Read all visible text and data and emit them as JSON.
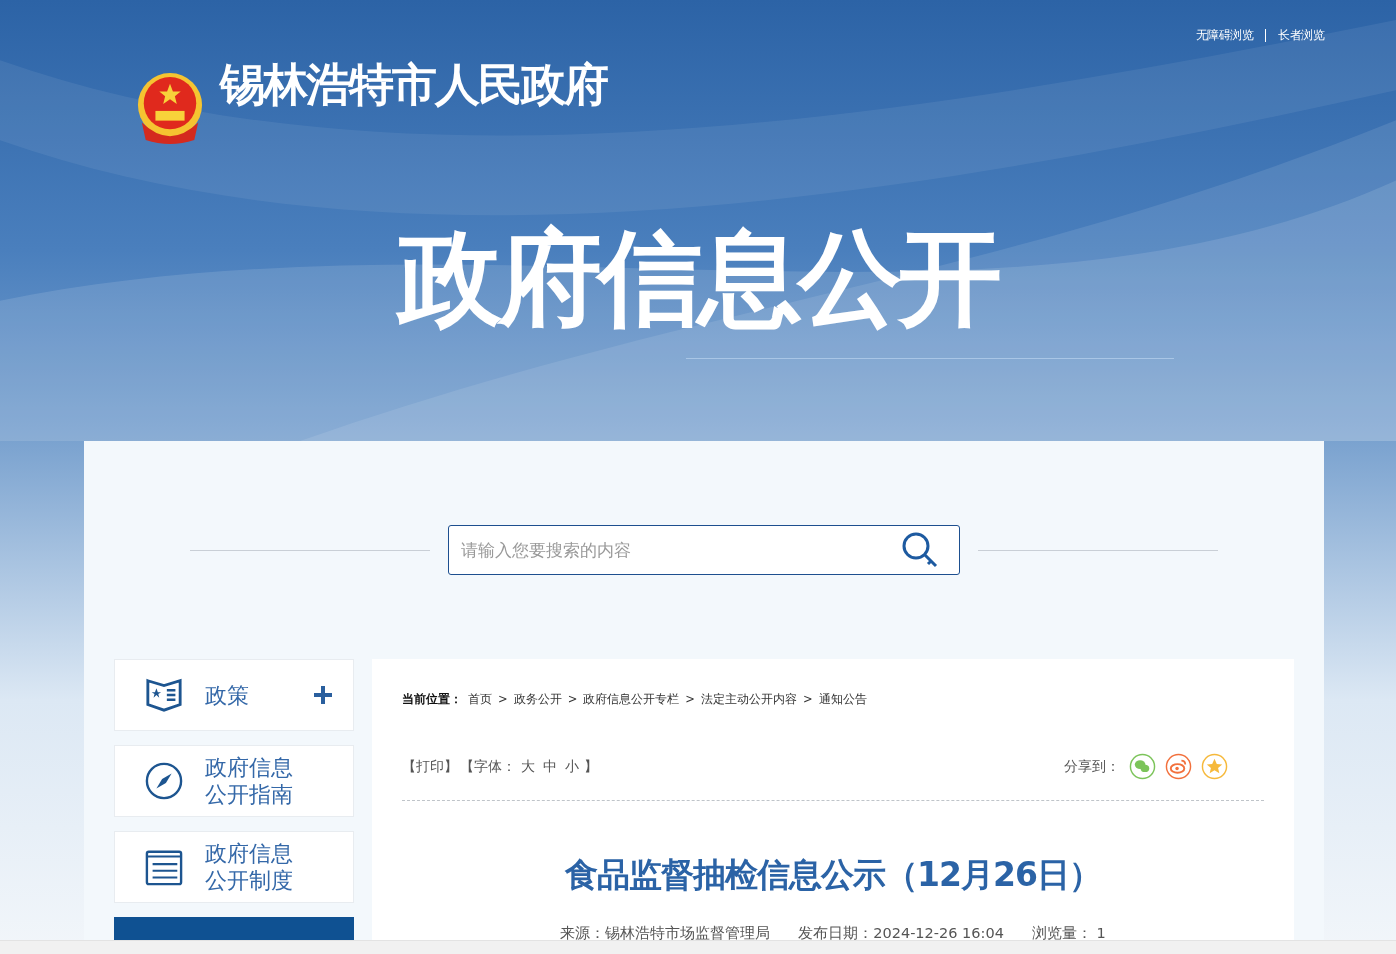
{
  "header": {
    "site_name": "锡林浩特市人民政府",
    "links": [
      {
        "label": "无障碍浏览"
      },
      {
        "label": "长者浏览"
      }
    ],
    "banner_title": "政府信息公开"
  },
  "search": {
    "placeholder": "请输入您要搜索的内容"
  },
  "sidebar": {
    "items": [
      {
        "label": "政策",
        "kind": "policy",
        "selected": false,
        "expandable": true
      },
      {
        "label": "政府信息公开指南",
        "kind": "guide",
        "selected": false,
        "expandable": false
      },
      {
        "label": "政府信息公开制度",
        "kind": "rules",
        "selected": false,
        "expandable": false
      },
      {
        "kind": "statutory",
        "selected": true,
        "expandable": false
      }
    ]
  },
  "breadcrumb": {
    "label": "当前位置：",
    "items": [
      "首页",
      "政务公开",
      "政府信息公开专栏",
      "法定主动公开内容",
      "通知公告"
    ],
    "separator": ">"
  },
  "tools": {
    "print": "【打印】",
    "font_label": "【字体：",
    "font_sizes": [
      "大",
      "中",
      "小"
    ],
    "font_end": "】",
    "share_label": "分享到：",
    "share": [
      {
        "kind": "wechat",
        "color": "#7cc45a"
      },
      {
        "kind": "weibo",
        "color": "#f2703c"
      },
      {
        "kind": "favorite",
        "color": "#f6b93b"
      }
    ]
  },
  "article": {
    "title": "食品监督抽检信息公示（12月26日）",
    "source": "来源：锡林浩特市场监督管理局",
    "date": "发布日期：2024-12-26 16:04",
    "views": "浏览量： 1"
  }
}
